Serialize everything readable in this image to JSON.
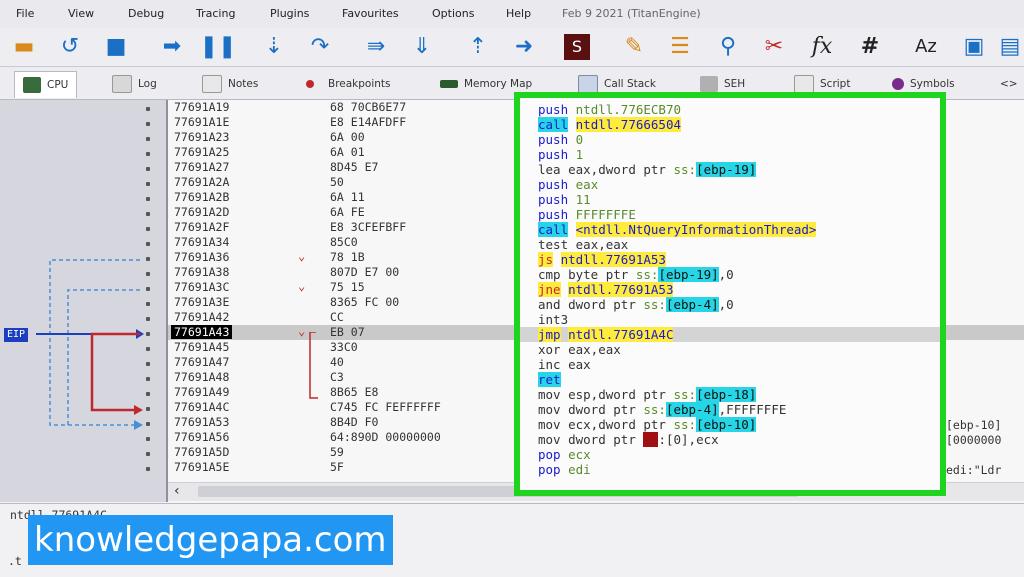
{
  "menu": [
    "File",
    "View",
    "Debug",
    "Tracing",
    "Plugins",
    "Favourites",
    "Options",
    "Help",
    "Feb 9 2021 (TitanEngine)"
  ],
  "toolbar_icons": [
    "open-icon",
    "restart-icon",
    "stop-icon",
    "run-icon",
    "pause-icon",
    "step-into-icon",
    "step-over-icon",
    "trace-into-icon",
    "trace-over-icon",
    "execute-till-return-icon",
    "run-to-user-code-icon",
    "scylla-icon",
    "patch-icon",
    "comments-icon",
    "labels-icon",
    "bookmarks-icon",
    "function-icon",
    "hash-icon",
    "font-icon",
    "calculator-icon",
    "sidebar-icon"
  ],
  "toolbar_glyphs": {
    "function": "fx",
    "hash": "#",
    "font": "Az"
  },
  "tabs": [
    "CPU",
    "Log",
    "Notes",
    "Breakpoints",
    "Memory Map",
    "Call Stack",
    "SEH",
    "Script",
    "Symbols",
    "<>"
  ],
  "rows": [
    {
      "addr": "77691A19",
      "bytes": "68 70CB6E77"
    },
    {
      "addr": "77691A1E",
      "bytes": "E8 E14AFDFF"
    },
    {
      "addr": "77691A23",
      "bytes": "6A 00"
    },
    {
      "addr": "77691A25",
      "bytes": "6A 01"
    },
    {
      "addr": "77691A27",
      "bytes": "8D45 E7"
    },
    {
      "addr": "77691A2A",
      "bytes": "50"
    },
    {
      "addr": "77691A2B",
      "bytes": "6A 11"
    },
    {
      "addr": "77691A2D",
      "bytes": "6A FE"
    },
    {
      "addr": "77691A2F",
      "bytes": "E8 3CFEFBFF"
    },
    {
      "addr": "77691A34",
      "bytes": "85C0"
    },
    {
      "addr": "77691A36",
      "bytes": "78 1B"
    },
    {
      "addr": "77691A38",
      "bytes": "807D E7 00"
    },
    {
      "addr": "77691A3C",
      "bytes": "75 15"
    },
    {
      "addr": "77691A3E",
      "bytes": "8365 FC 00"
    },
    {
      "addr": "77691A42",
      "bytes": "CC"
    },
    {
      "addr": "77691A43",
      "bytes": "EB 07"
    },
    {
      "addr": "77691A45",
      "bytes": "33C0"
    },
    {
      "addr": "77691A47",
      "bytes": "40"
    },
    {
      "addr": "77691A48",
      "bytes": "C3"
    },
    {
      "addr": "77691A49",
      "bytes": "8B65 E8"
    },
    {
      "addr": "77691A4C",
      "bytes": "C745 FC FEFFFFFF"
    },
    {
      "addr": "77691A53",
      "bytes": "8B4D F0"
    },
    {
      "addr": "77691A56",
      "bytes": "64:890D 00000000"
    },
    {
      "addr": "77691A5D",
      "bytes": "59"
    },
    {
      "addr": "77691A5E",
      "bytes": "5F"
    }
  ],
  "right_comments": [
    "[ebp-10]",
    "[0000000",
    "edi:\"Ldr"
  ],
  "disasm": {
    "l1": {
      "m": "push",
      "o": "ntdll.776ECB70"
    },
    "l2": {
      "m": "call",
      "o": "ntdll.77666504"
    },
    "l3": {
      "m": "push",
      "o": "0"
    },
    "l4": {
      "m": "push",
      "o": "1"
    },
    "l5": {
      "m": "lea",
      "o1": "eax,dword ptr",
      "o2": "ss:",
      "o3": "[ebp-19]"
    },
    "l6": {
      "m": "push",
      "o": "eax"
    },
    "l7": {
      "m": "push",
      "o": "11"
    },
    "l8": {
      "m": "push",
      "o": "FFFFFFFE"
    },
    "l9": {
      "m": "call",
      "o": "<ntdll.NtQueryInformationThread>"
    },
    "l10": {
      "m": "test",
      "o": "eax,eax"
    },
    "l11": {
      "m": "js",
      "o": "ntdll.77691A53"
    },
    "l12": {
      "m": "cmp",
      "o1": "byte ptr",
      "o2": "ss:",
      "o3": "[ebp-19]",
      "o4": ",0"
    },
    "l13": {
      "m": "jne",
      "o": "ntdll.77691A53"
    },
    "l14": {
      "m": "and",
      "o1": "dword ptr",
      "o2": "ss:",
      "o3": "[ebp-4]",
      "o4": ",0"
    },
    "l15": {
      "m": "int3"
    },
    "l16": {
      "m": "jmp",
      "o": "ntdll.77691A4C"
    },
    "l17": {
      "m": "xor",
      "o": "eax,eax"
    },
    "l18": {
      "m": "inc",
      "o": "eax"
    },
    "l19": {
      "m": "ret"
    },
    "l20": {
      "m": "mov",
      "o1": "esp,dword ptr",
      "o2": "ss:",
      "o3": "[ebp-18]"
    },
    "l21": {
      "m": "mov",
      "o1": "dword ptr",
      "o2": "ss:",
      "o3": "[ebp-4]",
      "o4": ",FFFFFFFE"
    },
    "l22": {
      "m": "mov",
      "o1": "ecx,dword ptr",
      "o2": "ss:",
      "o3": "[ebp-10]"
    },
    "l23": {
      "m": "mov",
      "o1": "dword ptr",
      "o2": "fs",
      "o3": ":[0],ecx"
    },
    "l24": {
      "m": "pop",
      "o": "ecx"
    },
    "l25": {
      "m": "pop",
      "o": "edi"
    }
  },
  "eip_label": "EIP",
  "bottom_info": "ntdll.77691A4C",
  "bottom_info2": ".t",
  "watermark": "knowledgepapa.com",
  "colors": {
    "highlight_border": "#1ed41e",
    "eip": "#1b3fbf",
    "jump_arrow": "#c0282d"
  }
}
